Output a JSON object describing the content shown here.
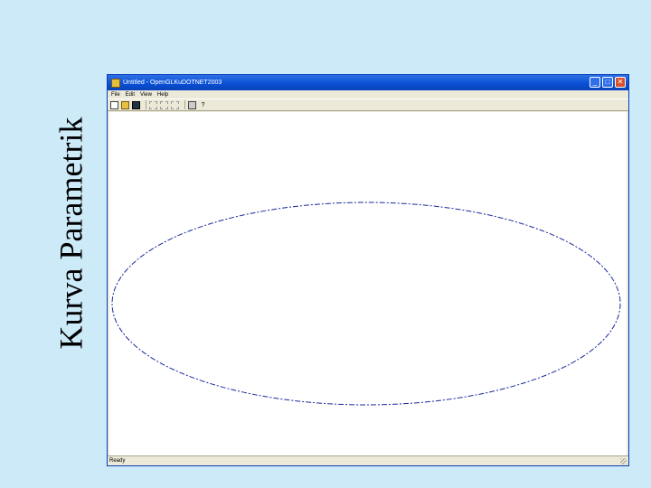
{
  "slide": {
    "title": "Kurva Parametrik"
  },
  "window": {
    "title": "Untitled - OpenGLKuDOTNET2003",
    "controls": {
      "minimize": "_",
      "maximize": "□",
      "close": "✕"
    }
  },
  "menu": {
    "items": [
      "File",
      "Edit",
      "View",
      "Help"
    ]
  },
  "toolbar": {
    "buttons": [
      {
        "name": "new-file-icon"
      },
      {
        "name": "open-folder-icon"
      },
      {
        "name": "save-icon"
      },
      {
        "name": "cut-icon"
      },
      {
        "name": "copy-icon"
      },
      {
        "name": "paste-icon"
      },
      {
        "name": "print-icon"
      },
      {
        "name": "help-icon",
        "glyph": "?"
      }
    ]
  },
  "status": {
    "text": "Ready"
  },
  "canvas": {
    "curve": "ellipse",
    "stroke_color": "#1a2a9a",
    "background": "#ffffff"
  }
}
